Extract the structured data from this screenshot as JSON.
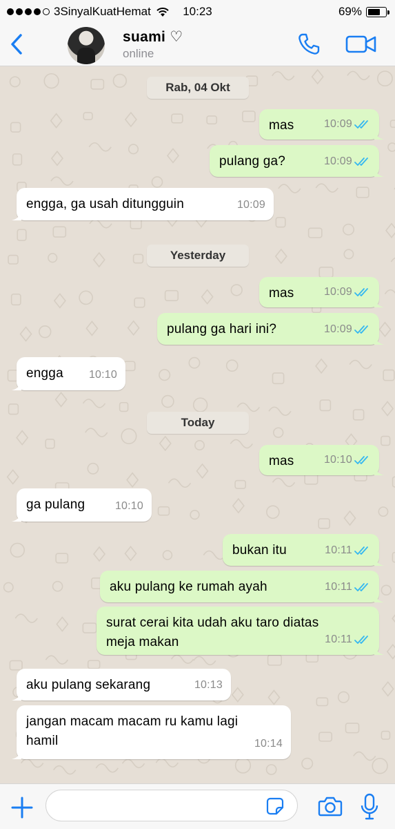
{
  "status_bar": {
    "carrier": "3SinyalKuatHemat",
    "time": "10:23",
    "battery_text": "69%",
    "battery_level": 0.69
  },
  "header": {
    "contact_name": "suami ♡",
    "contact_status": "online",
    "accent_color": "#1a7ef2"
  },
  "chat": {
    "items": [
      {
        "kind": "date",
        "label": "Rab, 04 Okt"
      },
      {
        "kind": "out",
        "text": "mas",
        "time": "10:09",
        "read": true
      },
      {
        "kind": "out",
        "text": "pulang ga?",
        "time": "10:09",
        "read": true
      },
      {
        "kind": "in",
        "text": "engga, ga usah ditungguin",
        "time": "10:09"
      },
      {
        "kind": "date",
        "label": "Yesterday"
      },
      {
        "kind": "out",
        "text": "mas",
        "time": "10:09",
        "read": true
      },
      {
        "kind": "out",
        "text": "pulang ga hari ini?",
        "time": "10:09",
        "read": true
      },
      {
        "kind": "in",
        "text": "engga",
        "time": "10:10"
      },
      {
        "kind": "date",
        "label": "Today"
      },
      {
        "kind": "out",
        "text": "mas",
        "time": "10:10",
        "read": true
      },
      {
        "kind": "in",
        "text": "ga pulang",
        "time": "10:10"
      },
      {
        "kind": "out",
        "text": "bukan itu",
        "time": "10:11",
        "read": true
      },
      {
        "kind": "out",
        "text": "aku pulang ke rumah ayah",
        "time": "10:11",
        "read": true
      },
      {
        "kind": "out",
        "text": "surat cerai kita udah aku taro diatas\nmeja makan",
        "time": "10:11",
        "read": true
      },
      {
        "kind": "in",
        "text": "aku pulang sekarang",
        "time": "10:13"
      },
      {
        "kind": "in",
        "text": "jangan macam macam ru kamu lagi\nhamil",
        "time": "10:14"
      }
    ],
    "read_tick_color": "#34b7f1",
    "outgoing_bubble_color": "#dcf8c6",
    "incoming_bubble_color": "#ffffff",
    "wallpaper_color": "#e6dfd6"
  },
  "input_bar": {
    "placeholder": "",
    "value": ""
  },
  "icons": {
    "back": "chevron-left-icon",
    "call": "phone-icon",
    "video": "video-camera-icon",
    "attach": "plus-icon",
    "sticker": "sticker-icon",
    "camera": "camera-icon",
    "mic": "microphone-icon"
  }
}
